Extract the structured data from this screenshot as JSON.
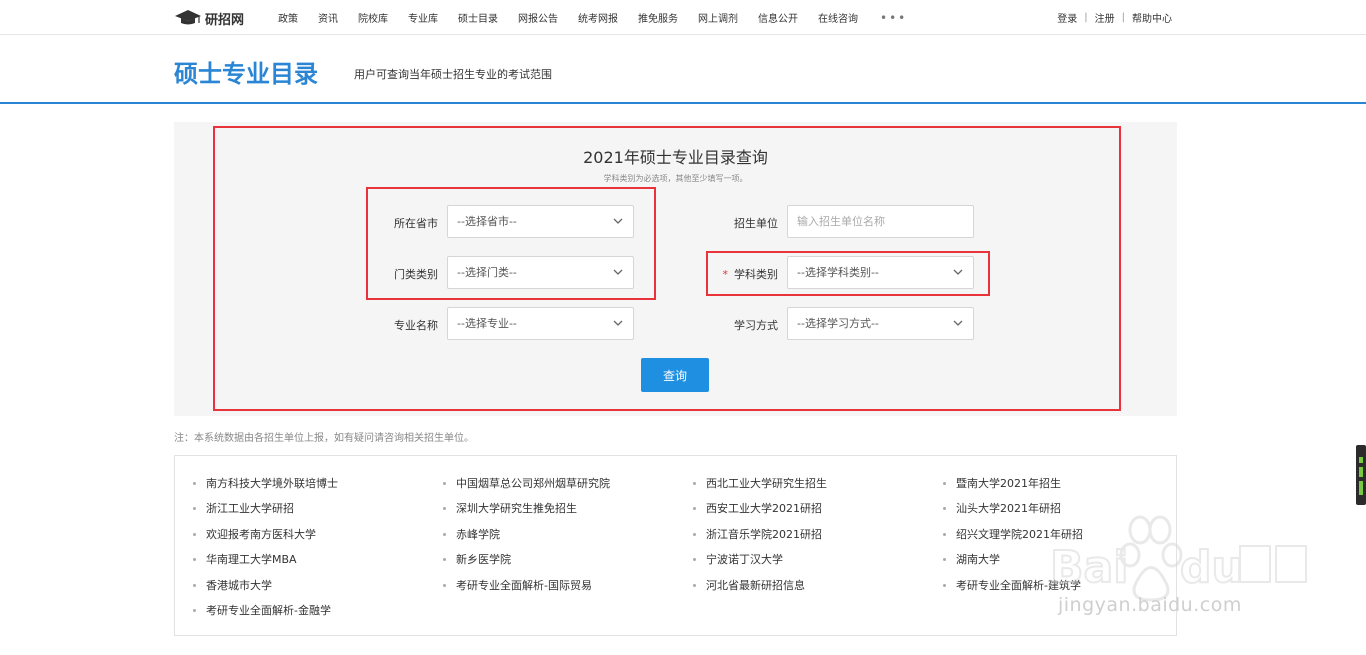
{
  "nav": {
    "logo": "研招网",
    "items": [
      "政策",
      "资讯",
      "院校库",
      "专业库",
      "硕士目录",
      "网报公告",
      "统考网报",
      "推免服务",
      "网上调剂",
      "信息公开",
      "在线咨询"
    ],
    "more": "•••",
    "right": {
      "login": "登录",
      "register": "注册",
      "help": "帮助中心"
    }
  },
  "header": {
    "title": "硕士专业目录",
    "subtitle": "用户可查询当年硕士招生专业的考试范围"
  },
  "search": {
    "title": "2021年硕士专业目录查询",
    "hint": "学科类别为必选项，其他至少填写一项。",
    "province_label": "所在省市",
    "province_value": "--选择省市--",
    "unit_label": "招生单位",
    "unit_placeholder": "输入招生单位名称",
    "category_label": "门类类别",
    "category_value": "--选择门类--",
    "subject_required": "*",
    "subject_label": "学科类别",
    "subject_value": "--选择学科类别--",
    "major_label": "专业名称",
    "major_value": "--选择专业--",
    "mode_label": "学习方式",
    "mode_value": "--选择学习方式--",
    "query_button": "查询"
  },
  "note": "注：本系统数据由各招生单位上报，如有疑问请咨询相关招生单位。",
  "links": [
    [
      "南方科技大学境外联培博士",
      "中国烟草总公司郑州烟草研究院",
      "西北工业大学研究生招生",
      "暨南大学2021年招生"
    ],
    [
      "浙江工业大学研招",
      "深圳大学研究生推免招生",
      "西安工业大学2021研招",
      "汕头大学2021年研招"
    ],
    [
      "欢迎报考南方医科大学",
      "赤峰学院",
      "浙江音乐学院2021研招",
      "绍兴文理学院2021年研招"
    ],
    [
      "华南理工大学MBA",
      "新乡医学院",
      "宁波诺丁汉大学",
      "湖南大学"
    ],
    [
      "香港城市大学",
      "考研专业全面解析-国际贸易",
      "河北省最新研招信息",
      "考研专业全面解析-建筑学"
    ],
    [
      "考研专业全面解析-金融学"
    ]
  ],
  "watermark": {
    "text": "jingyan.baidu.com"
  }
}
